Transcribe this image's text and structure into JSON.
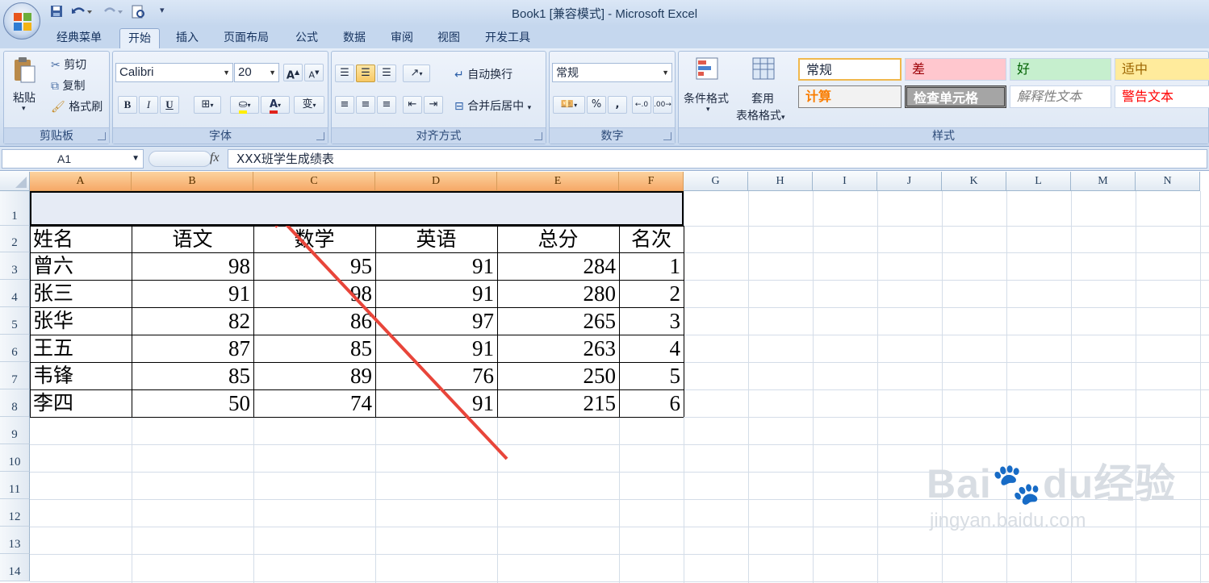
{
  "window": {
    "title": "Book1  [兼容模式] - Microsoft Excel"
  },
  "tabs": [
    "经典菜单",
    "开始",
    "插入",
    "页面布局",
    "公式",
    "数据",
    "审阅",
    "视图",
    "开发工具"
  ],
  "active_tab": "开始",
  "clipboard": {
    "paste": "粘贴",
    "cut": "剪切",
    "copy": "复制",
    "format_painter": "格式刷",
    "label": "剪贴板"
  },
  "font": {
    "name": "Calibri",
    "size": "20",
    "label": "字体",
    "bold": "B",
    "italic": "I",
    "underline": "U",
    "grow": "A",
    "shrink": "A",
    "color_letter": "A",
    "phonetic": "变"
  },
  "alignment": {
    "wrap": "自动换行",
    "merge": "合并后居中",
    "label": "对齐方式"
  },
  "number": {
    "format": "常规",
    "percent": "%",
    "comma": ",",
    "label": "数字"
  },
  "styles": {
    "conditional": "条件格式",
    "table_format_1": "套用",
    "table_format_2": "表格格式",
    "label": "样式",
    "cells": [
      "常规",
      "差",
      "好",
      "适中",
      "计算",
      "检查单元格",
      "解释性文本",
      "警告文本"
    ]
  },
  "formula_bar": {
    "name_box": "A1",
    "fx": "fx",
    "content": "XXX班学生成绩表"
  },
  "columns": [
    "A",
    "B",
    "C",
    "D",
    "E",
    "F",
    "G",
    "H",
    "I",
    "J",
    "K",
    "L",
    "M",
    "N"
  ],
  "rows": [
    "1",
    "2",
    "3",
    "4",
    "5",
    "6",
    "7",
    "8",
    "9",
    "10",
    "11",
    "12",
    "13",
    "14"
  ],
  "sheet": {
    "title": "XXX班学生成绩表",
    "headers": [
      "姓名",
      "语文",
      "数学",
      "英语",
      "总分",
      "名次"
    ],
    "data": [
      [
        "曾六",
        "98",
        "95",
        "91",
        "284",
        "1"
      ],
      [
        "张三",
        "91",
        "98",
        "91",
        "280",
        "2"
      ],
      [
        "张华",
        "82",
        "86",
        "97",
        "265",
        "3"
      ],
      [
        "王五",
        "87",
        "85",
        "91",
        "263",
        "4"
      ],
      [
        "韦锋",
        "85",
        "89",
        "76",
        "250",
        "5"
      ],
      [
        "李四",
        "50",
        "74",
        "91",
        "215",
        "6"
      ]
    ]
  },
  "watermark": {
    "brand": "Bai",
    "brand2": "du",
    "product": "经验",
    "url": "jingyan.baidu.com"
  },
  "colors": {
    "title_red": "#e0231c",
    "selected_header": "#f6a968",
    "arrow": "#e8453a"
  }
}
